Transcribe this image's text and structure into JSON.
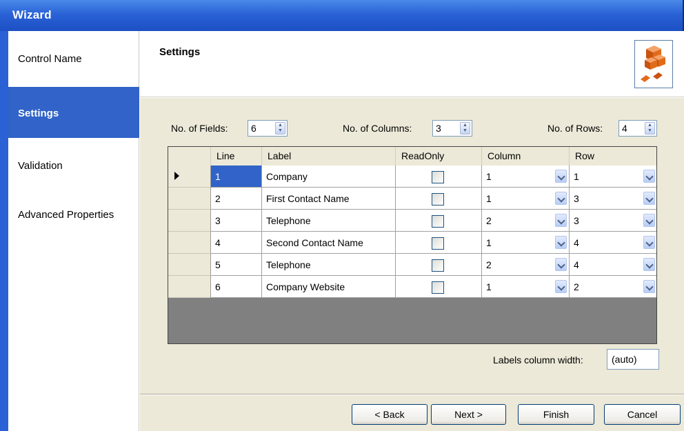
{
  "window": {
    "title": "Wizard"
  },
  "sidebar": {
    "items": [
      {
        "label": "Control Name",
        "active": false
      },
      {
        "label": "Settings",
        "active": true
      },
      {
        "label": "Validation",
        "active": false
      },
      {
        "label": "Advanced Properties",
        "active": false
      }
    ]
  },
  "header": {
    "title": "Settings",
    "icon": "blocks-icon"
  },
  "settings": {
    "fields": {
      "label": "No. of Fields:",
      "value": "6"
    },
    "columns": {
      "label": "No. of Columns:",
      "value": "3"
    },
    "rows": {
      "label": "No. of Rows:",
      "value": "4"
    }
  },
  "grid": {
    "headers": [
      "Line",
      "Label",
      "ReadOnly",
      "Column",
      "Row"
    ],
    "rows": [
      {
        "line": "1",
        "label": "Company",
        "readonly": false,
        "column": "1",
        "row": "1",
        "current": true
      },
      {
        "line": "2",
        "label": "First Contact Name",
        "readonly": false,
        "column": "1",
        "row": "3"
      },
      {
        "line": "3",
        "label": "Telephone",
        "readonly": false,
        "column": "2",
        "row": "3"
      },
      {
        "line": "4",
        "label": "Second Contact Name",
        "readonly": false,
        "column": "1",
        "row": "4"
      },
      {
        "line": "5",
        "label": "Telephone",
        "readonly": false,
        "column": "2",
        "row": "4"
      },
      {
        "line": "6",
        "label": "Company Website",
        "readonly": false,
        "column": "1",
        "row": "2"
      }
    ]
  },
  "labels_width": {
    "label": "Labels column width:",
    "value": "(auto)"
  },
  "buttons": {
    "back": "< Back",
    "next": "Next >",
    "finish": "Finish",
    "cancel": "Cancel"
  },
  "colors": {
    "titlebar": "#2a62d6",
    "active_nav": "#3163c8",
    "panel": "#ece9d8",
    "selection": "#3163c8",
    "accent_icon": "#e06c1a"
  }
}
